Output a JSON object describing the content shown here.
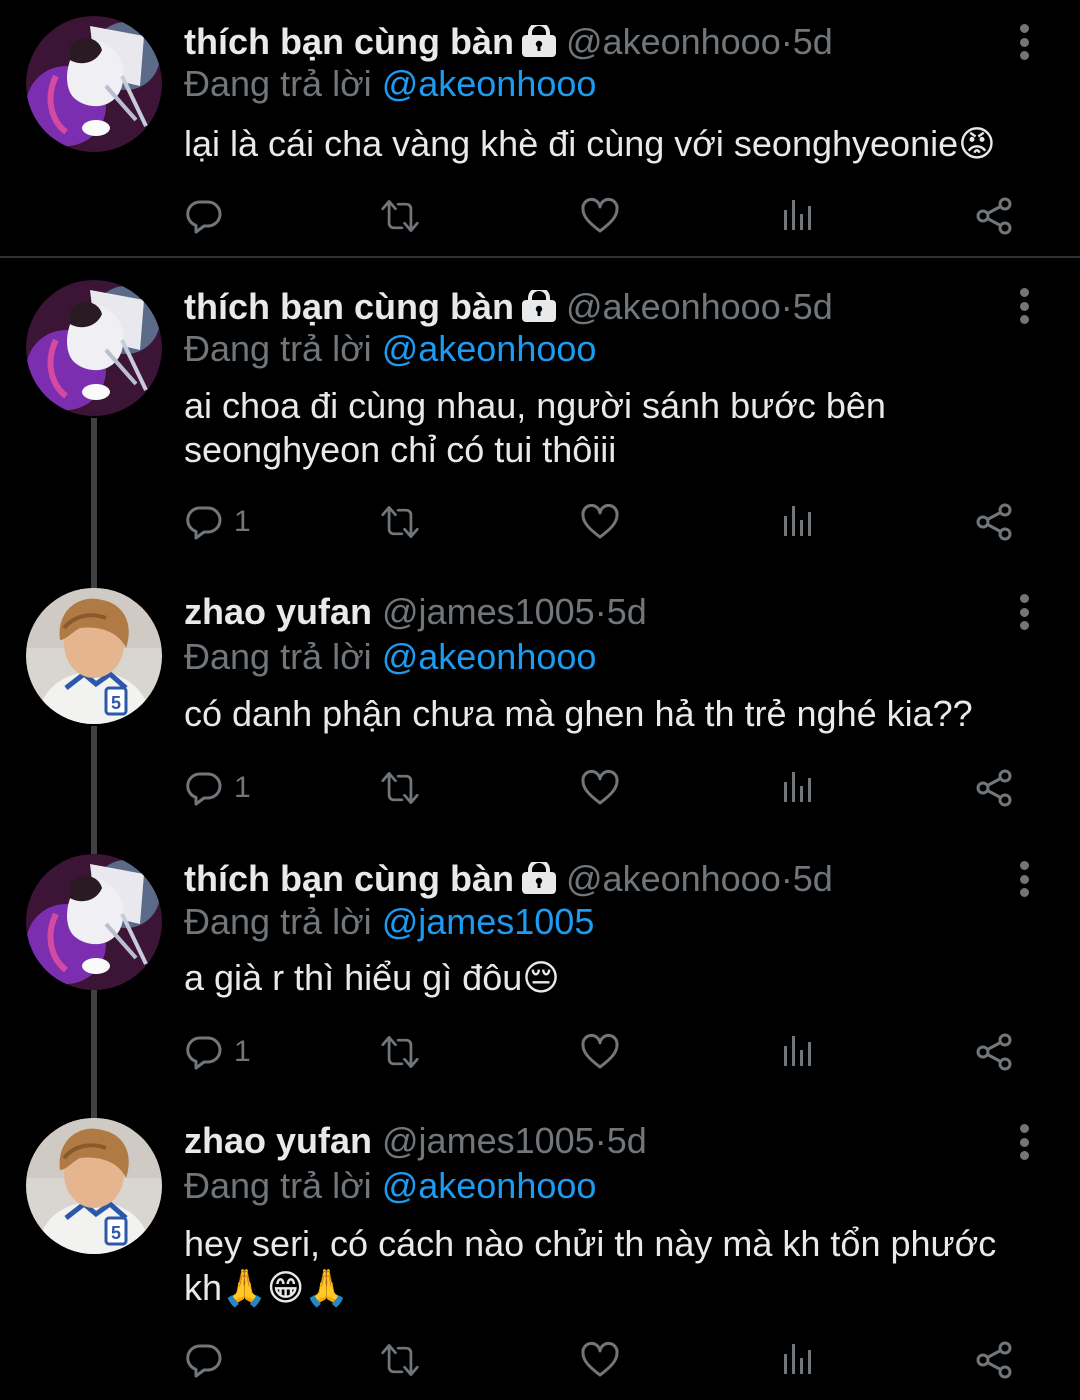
{
  "tweets": [
    {
      "name": "thích bạn cùng bàn",
      "locked": true,
      "handle": "@akeonhooo",
      "dot": "·",
      "time": "5d",
      "reply_prefix": "Đang trả lời ",
      "reply_to": "@akeonhooo",
      "text": "lại là cái cha vàng khè đi cùng với seonghyeonie😡",
      "reply_count": "",
      "avatar": "avatar-akeonhooo"
    },
    {
      "name": "thích bạn cùng bàn",
      "locked": true,
      "handle": "@akeonhooo",
      "dot": "·",
      "time": "5d",
      "reply_prefix": "Đang trả lời ",
      "reply_to": "@akeonhooo",
      "text": "ai choa đi cùng nhau, người sánh bước bên seonghyeon chỉ có tui thôiii",
      "reply_count": "1",
      "avatar": "avatar-akeonhooo"
    },
    {
      "name": "zhao yufan",
      "locked": false,
      "handle": "@james1005",
      "dot": "·",
      "time": "5d",
      "reply_prefix": "Đang trả lời ",
      "reply_to": "@akeonhooo",
      "text": "có danh phận chưa mà ghen hả th trẻ nghé kia??",
      "reply_count": "1",
      "avatar": "avatar-james1005"
    },
    {
      "name": "thích bạn cùng bàn",
      "locked": true,
      "handle": "@akeonhooo",
      "dot": "·",
      "time": "5d",
      "reply_prefix": "Đang trả lời ",
      "reply_to": "@james1005",
      "text": "a già r thì hiểu gì đôu😔",
      "reply_count": "1",
      "avatar": "avatar-akeonhooo"
    },
    {
      "name": "zhao yufan",
      "locked": false,
      "handle": "@james1005",
      "dot": "·",
      "time": "5d",
      "reply_prefix": "Đang trả lời ",
      "reply_to": "@akeonhooo",
      "text": "hey seri, có cách nào chửi th này mà kh tổn phước kh🙏😁🙏",
      "reply_count": "",
      "avatar": "avatar-james1005"
    }
  ],
  "icons": [
    "reply-icon",
    "retweet-icon",
    "like-icon",
    "views-icon",
    "share-icon",
    "more-icon",
    "lock-icon"
  ],
  "colors": {
    "background": "#000000",
    "text": "#e7e9ea",
    "muted": "#71767b",
    "mention": "#1d9bf0",
    "divider": "#2f3336"
  }
}
